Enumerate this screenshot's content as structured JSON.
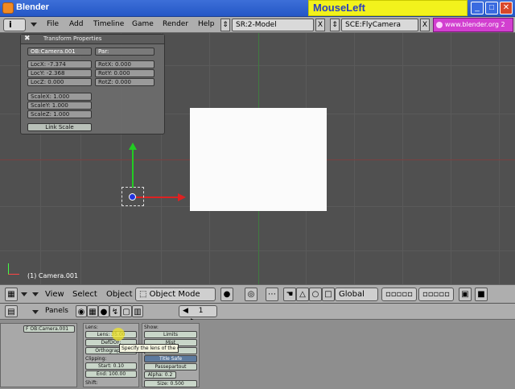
{
  "window": {
    "title": "Blender",
    "mouse_indicator": "MouseLeft",
    "min_glyph": "_",
    "max_glyph": "□",
    "close_glyph": "✕"
  },
  "topbar": {
    "info_glyph": "i",
    "menus": [
      "File",
      "Add",
      "Timeline",
      "Game",
      "Render",
      "Help"
    ],
    "screen_field": "SR:2-Model",
    "scene_field": "SCE:FlyCamera",
    "url": "www.blender.org 2",
    "x_glyph": "X"
  },
  "transform_panel": {
    "title": "Transform Properties",
    "close_glyph": "✖",
    "object_name": "OB:Camera.001",
    "parent": "Par:",
    "loc": [
      "LocX: -7.374",
      "LocY: -2.368",
      "LocZ: 0.000"
    ],
    "rot": [
      "RotX: 0.000",
      "RotY: 0.000",
      "RotZ: 0.000"
    ],
    "scale": [
      "ScaleX: 1.000",
      "ScaleY: 1.000",
      "ScaleZ: 1.000"
    ],
    "link_scale": "Link Scale"
  },
  "viewport": {
    "label": "(1) Camera.001"
  },
  "view_header": {
    "menus": [
      "View",
      "Select",
      "Object"
    ],
    "mode": "Object Mode",
    "orientation": "Global",
    "mode_icon": "cube-icon",
    "mode_chevron": "⇕"
  },
  "buttons_header": {
    "panels_label": "Panels",
    "frame": "1",
    "left_arrow": "◀",
    "right_arrow": "▶"
  },
  "buttons_window": {
    "object_field": "F OB:Camera.001",
    "lens_label": "Lens:",
    "lens_value": "Lens: 35.00",
    "defdof": "DefDOF:",
    "orthographic": "Orthographic",
    "clipping_label": "Clipping:",
    "clip_start": "Start: 0.10",
    "clip_end": "End: 100.00",
    "shift_label": "Shift:",
    "show_label": "Show:",
    "show_buttons": [
      "Limits",
      "Mist",
      "Name",
      "Title Safe",
      "Passepartout"
    ],
    "alpha": "Alpha: 0.2",
    "size": "Size: 0.500",
    "tooltip": "Specify the lens of the camera"
  }
}
